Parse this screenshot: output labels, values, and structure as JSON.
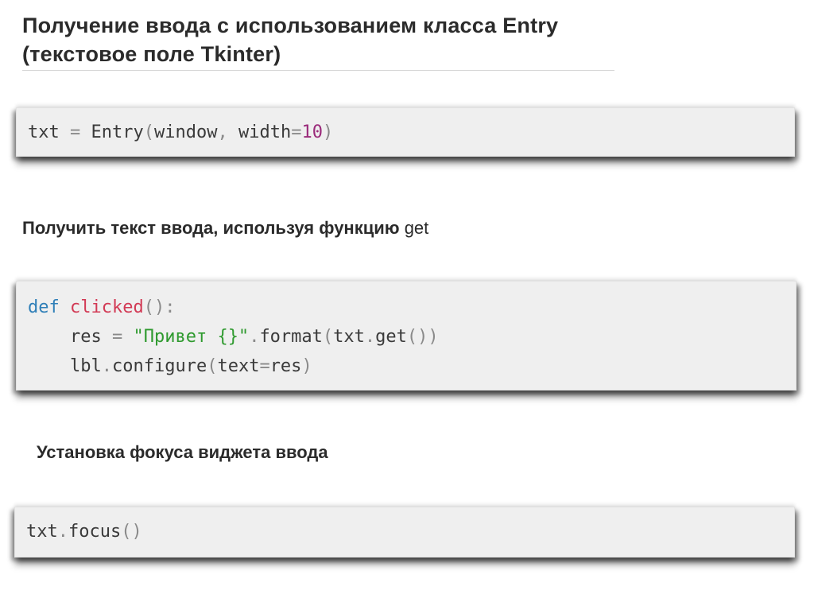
{
  "title": {
    "line1": "Получение ввода с использованием класса Entry",
    "line2": "(текстовое поле Tkinter)"
  },
  "code1": {
    "line1": {
      "t1": "txt",
      "t2": " = ",
      "t3": "Entry",
      "t4": "(",
      "t5": "window",
      "t6": ", ",
      "t7": "width",
      "t8": "=",
      "t9": "10",
      "t10": ")"
    }
  },
  "heading2": {
    "text": "Получить текст ввода, используя функцию ",
    "suffix": "get"
  },
  "code2": {
    "line1": {
      "kw": "def",
      "sp": " ",
      "fn": "clicked",
      "p": "():"
    },
    "line2": {
      "indent": "    ",
      "t1": "res",
      "t2": " = ",
      "str": "\"Привет {}\"",
      "t3": ".",
      "t4": "format",
      "t5": "(",
      "t6": "txt",
      "t7": ".",
      "t8": "get",
      "t9": "())"
    },
    "line3": {
      "indent": "    ",
      "t1": "lbl",
      "t2": ".",
      "t3": "configure",
      "t4": "(",
      "t5": "text",
      "t6": "=",
      "t7": "res",
      "t8": ")"
    }
  },
  "heading3": {
    "text": "Установка фокуса виджета ввода"
  },
  "code3": {
    "line1": {
      "t1": "txt",
      "t2": ".",
      "t3": "focus",
      "t4": "()"
    }
  },
  "colors": {
    "keyword": "#2f7fb8",
    "function_name": "#d23a55",
    "string": "#2f9a2f",
    "number": "#9a2a7a",
    "operator": "#8a8a8a",
    "code_background": "#efefef"
  }
}
